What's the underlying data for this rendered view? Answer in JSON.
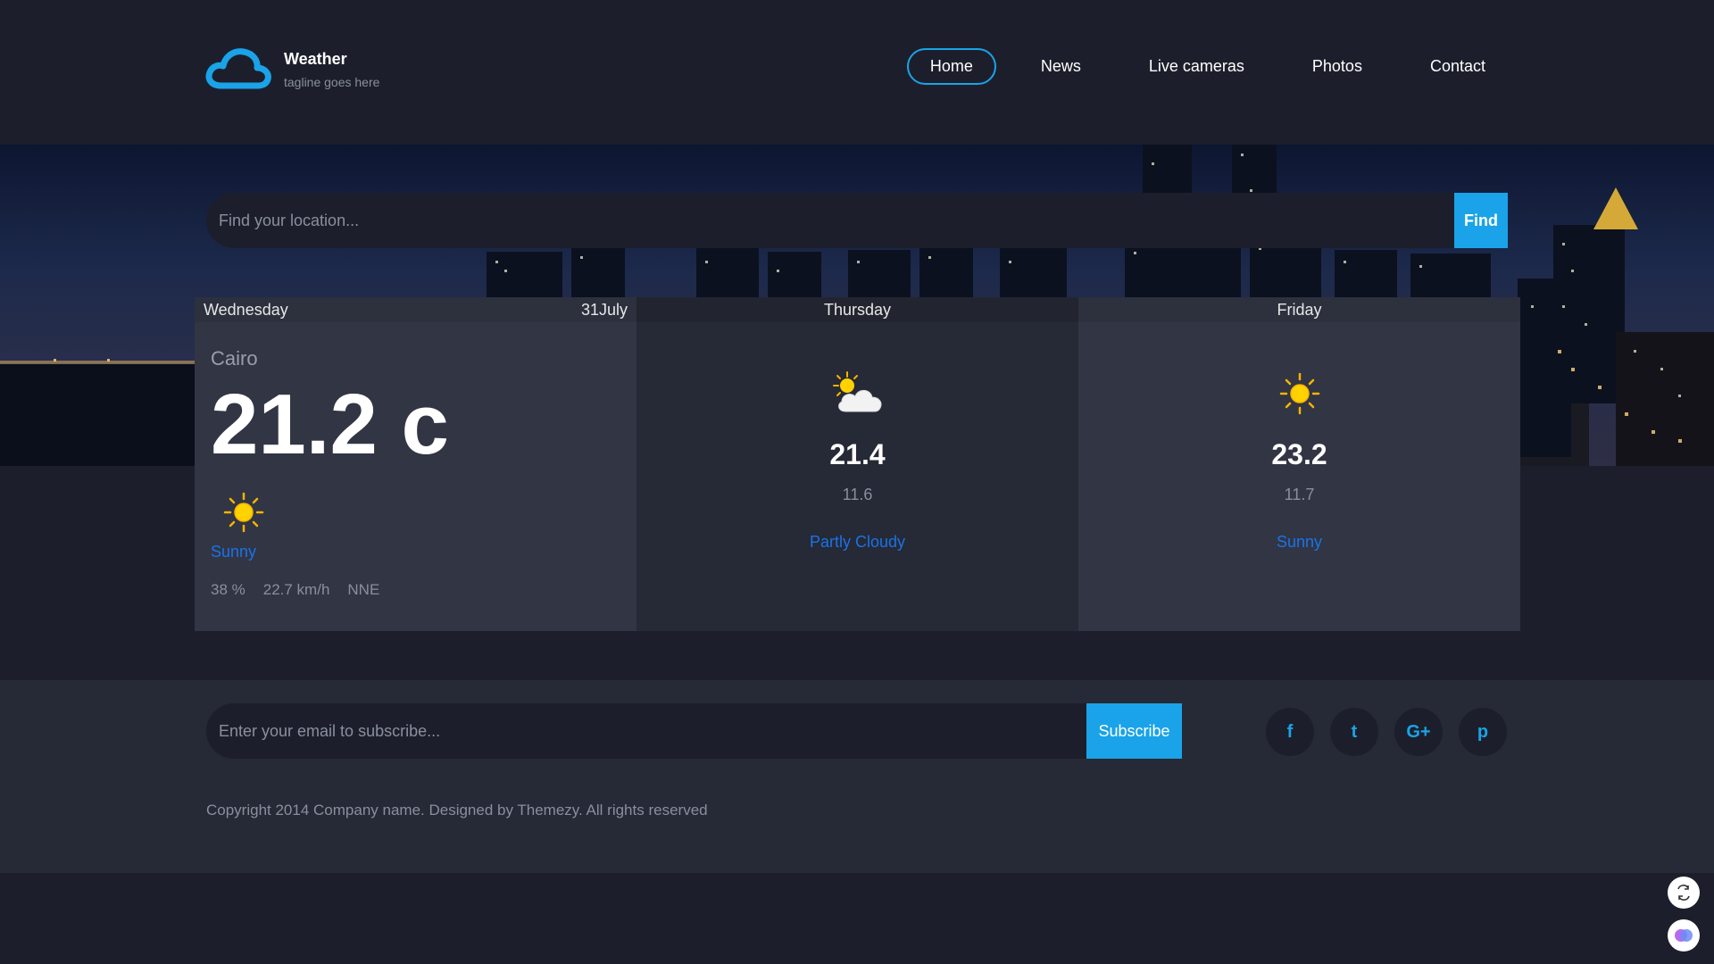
{
  "header": {
    "brand": "Weather",
    "tagline": "tagline goes here",
    "nav": [
      {
        "label": "Home",
        "active": true
      },
      {
        "label": "News"
      },
      {
        "label": "Live cameras"
      },
      {
        "label": "Photos"
      },
      {
        "label": "Contact"
      }
    ]
  },
  "search": {
    "placeholder": "Find your location...",
    "button": "Find"
  },
  "today": {
    "day": "Wednesday",
    "date": "31July",
    "city": "Cairo",
    "temp": "21.2 c",
    "icon": "sun-icon",
    "condition": "Sunny",
    "humidity": "38 %",
    "wind_speed": "22.7 km/h",
    "wind_dir": "NNE"
  },
  "forecast": [
    {
      "day": "Thursday",
      "icon": "partly-cloudy-icon",
      "max": "21.4",
      "min": "11.6",
      "condition": "Partly Cloudy"
    },
    {
      "day": "Friday",
      "icon": "sun-icon",
      "max": "23.2",
      "min": "11.7",
      "condition": "Sunny"
    }
  ],
  "footer": {
    "subscribe_placeholder": "Enter your email to subscribe...",
    "subscribe_button": "Subscribe",
    "socials": [
      {
        "glyph": "f",
        "icon": "facebook-icon"
      },
      {
        "glyph": "t",
        "icon": "twitter-icon"
      },
      {
        "glyph": "G+",
        "icon": "google-plus-icon"
      },
      {
        "glyph": "p",
        "icon": "pinterest-icon"
      }
    ],
    "copyright": "Copyright 2014 Company name. Designed by Themezy. All rights reserved"
  },
  "colors": {
    "accent": "#1aa3e8",
    "condition_text": "#1a73e8",
    "background": "#1c1f2b"
  }
}
